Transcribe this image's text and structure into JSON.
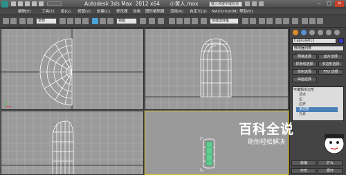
{
  "window": {
    "title": "Autodesk 3ds Max  2012 x64      小黄人.max",
    "search_placeholder": "键入关键字或短语",
    "minimize": "–",
    "maximize": "□",
    "close": "✕"
  },
  "menu": [
    "编辑(E)",
    "工具(T)",
    "组(G)",
    "视图(V)",
    "创建(C)",
    "修改器",
    "动画",
    "图形编辑器",
    "渲染(R)",
    "自定义(U)",
    "MAXScript(M)",
    "帮助(H)"
  ],
  "toolbar": {
    "selection_filter": "全部",
    "reference_coord": "视图",
    "named_selection": "创建选择集"
  },
  "command_panel": {
    "object_name": "Capsule012",
    "modifier_list_label": "修改器列表",
    "buttons": [
      "网格选择",
      "面片选择",
      "样条线选择",
      "多边形选择",
      "体积选择",
      "FFD 选择",
      "曲面选择"
    ],
    "stack_root": "可编辑多边形",
    "stack_items": [
      "顶点",
      "边",
      "边界",
      "多边形",
      "元素"
    ],
    "selected_item": "多边形",
    "bottom_buttons": [
      "收缩",
      "扩大",
      "环形",
      "循环"
    ]
  },
  "watermark": {
    "title": "百科全说",
    "subtitle": "助你轻松解决"
  },
  "colors": {
    "viewport_bg": "#9a9a9a",
    "grid_line": "#b5b5b5",
    "wireframe": "#ffffff",
    "active_border": "#e2c020",
    "selection_highlight": "#4a7fb8",
    "object_selected": "#5fd090"
  }
}
